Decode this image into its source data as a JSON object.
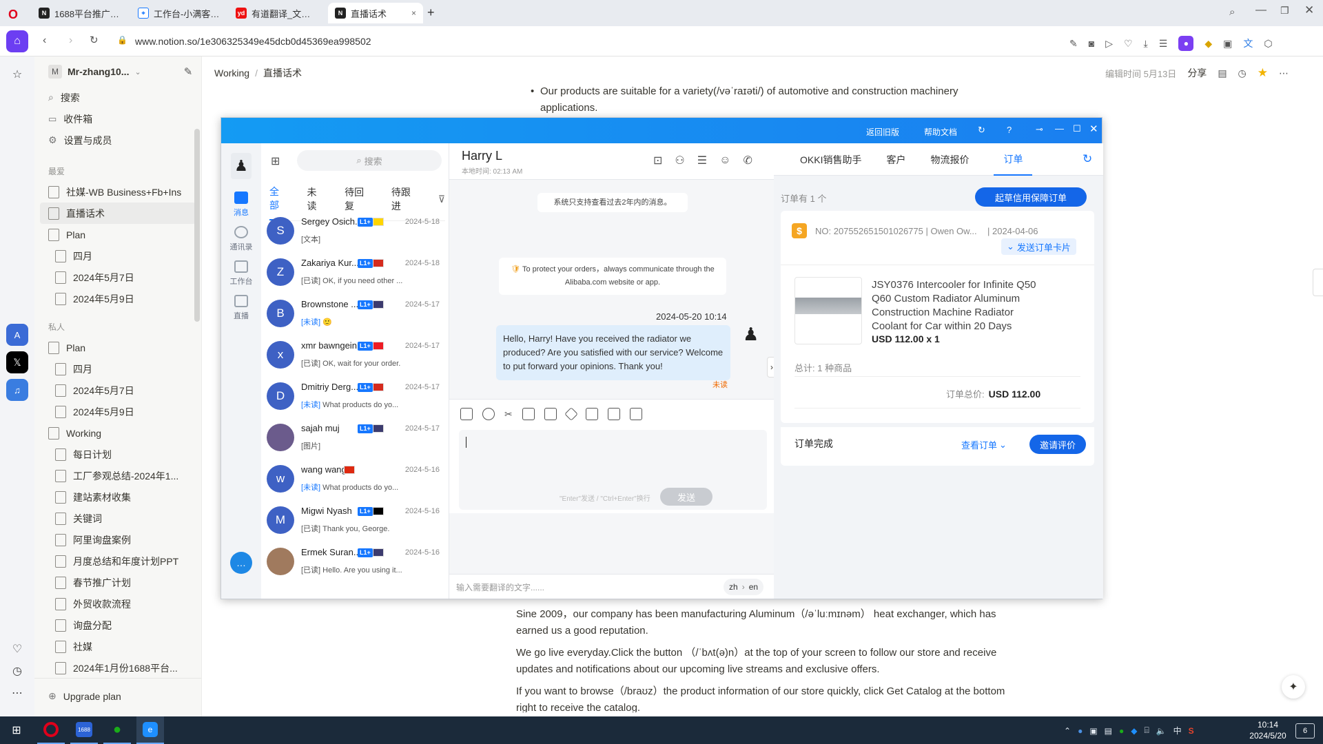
{
  "browser": {
    "tabs": [
      {
        "title": "1688平台推广营销优化 · Notion",
        "favicon": "N"
      },
      {
        "title": "工作台-小满客户管理",
        "favicon": "pin"
      },
      {
        "title": "有道翻译_文本、文档、网",
        "favicon": "yd"
      },
      {
        "title": "直播话术",
        "favicon": "N",
        "close": "×"
      }
    ],
    "new_tab": "+",
    "url": "www.notion.so/1e306325349e45dcb0d45369ea998502"
  },
  "notion": {
    "workspace": "Mr-zhang10...",
    "workspace_avatar": "M",
    "nav": [
      {
        "label": "搜索",
        "icon": "search-icon"
      },
      {
        "label": "收件箱",
        "icon": "inbox-icon"
      },
      {
        "label": "设置与成员",
        "icon": "gear-icon"
      }
    ],
    "favorites_heading": "最爱",
    "favorites": [
      {
        "label": "社媒-WB Business+Fb+Ins",
        "level": 0
      },
      {
        "label": "直播话术",
        "level": 0,
        "active": true
      },
      {
        "label": "Plan",
        "level": 0
      },
      {
        "label": "四月",
        "level": 1
      },
      {
        "label": "2024年5月7日",
        "level": 1
      },
      {
        "label": "2024年5月9日",
        "level": 1
      }
    ],
    "private_heading": "私人",
    "private": [
      {
        "label": "Plan",
        "level": 0
      },
      {
        "label": "四月",
        "level": 1
      },
      {
        "label": "2024年5月7日",
        "level": 1
      },
      {
        "label": "2024年5月9日",
        "level": 1
      },
      {
        "label": "Working",
        "level": 0
      },
      {
        "label": "每日计划",
        "level": 1
      },
      {
        "label": "工厂参观总结-2024年1...",
        "level": 1
      },
      {
        "label": "建站素材收集",
        "level": 1
      },
      {
        "label": "关键词",
        "level": 1
      },
      {
        "label": "阿里询盘案例",
        "level": 1
      },
      {
        "label": "月度总结和年度计划PPT",
        "level": 1
      },
      {
        "label": "春节推广计划",
        "level": 1
      },
      {
        "label": "外贸收款流程",
        "level": 1
      },
      {
        "label": "询盘分配",
        "level": 1
      },
      {
        "label": "社媒",
        "level": 1
      },
      {
        "label": "2024年1月份1688平台...",
        "level": 1
      }
    ],
    "upgrade": "Upgrade plan",
    "breadcrumb": [
      "Working",
      "/",
      "直播话术"
    ],
    "edited": "编辑时间 5月13日",
    "share": "分享",
    "doc_top": "Our products are suitable for a variety(/vəˈraɪəti/) of automotive and construction machinery applications.",
    "doc_paras": [
      "Sine 2009，our company has been manufacturing Aluminum（/əˈluːmɪnəm） heat exchanger, which has earned us a good reputation.",
      "We go live everyday.Click the button （/ˈbʌt(ə)n）at the top of your screen to follow our store and receive updates and notifications about our upcoming live streams and exclusive offers.",
      "If you want to browse（/braʊz）the product information of our store quickly, click Get Catalog at the bottom right to receive the catalog."
    ]
  },
  "chat": {
    "header_buttons": [
      "返回旧版",
      "帮助文档"
    ],
    "nav": [
      {
        "label": "消息",
        "active": true
      },
      {
        "label": "通讯录"
      },
      {
        "label": "工作台"
      },
      {
        "label": "直播"
      }
    ],
    "search_placeholder": "搜索",
    "filter_tabs": [
      "全部",
      "未读",
      "待回复",
      "待跟进"
    ],
    "conversations": [
      {
        "initial": "S",
        "name": "Sergey Osich...",
        "badge": "L1+",
        "date": "2024-5-18",
        "tag": "",
        "preview": "[文本]",
        "color": "#3e61c4"
      },
      {
        "initial": "Z",
        "name": "Zakariya Kur...",
        "badge": "L1+",
        "date": "2024-5-18",
        "tag": "",
        "preview": "[已读] OK, if you need other ...",
        "color": "#3e61c4"
      },
      {
        "initial": "B",
        "name": "Brownstone ...",
        "badge": "L1+",
        "date": "2024-5-17",
        "tag": "[未读]",
        "preview": " 🙂",
        "color": "#3e61c4"
      },
      {
        "initial": "x",
        "name": "xmr bawngein",
        "badge": "L1+",
        "date": "2024-5-17",
        "tag": "",
        "preview": "[已读] OK, wait for your order.",
        "color": "#3e61c4"
      },
      {
        "initial": "D",
        "name": "Dmitriy Derg...",
        "badge": "L1+",
        "date": "2024-5-17",
        "tag": "[未读]",
        "preview": " What products do yo...",
        "color": "#3e61c4"
      },
      {
        "initial": "",
        "name": "sajah muj",
        "badge": "L1+",
        "date": "2024-5-17",
        "tag": "",
        "preview": "[图片]",
        "color": "#6b5b8c"
      },
      {
        "initial": "w",
        "name": "wang wang",
        "badge": "",
        "date": "2024-5-16",
        "tag": "[未读]",
        "preview": " What products do yo...",
        "color": "#3e61c4"
      },
      {
        "initial": "M",
        "name": "Migwi Nyash",
        "badge": "L1+",
        "date": "2024-5-16",
        "tag": "",
        "preview": "[已读] Thank you, George.",
        "color": "#3e61c4"
      },
      {
        "initial": "",
        "name": "Ermek Suran...",
        "badge": "L1+",
        "date": "2024-5-16",
        "tag": "",
        "preview": "[已读] Hello. Are you using it...",
        "color": "#a07a5e"
      }
    ],
    "contact_name": "Harry L",
    "local_time": "本地时间: 02:13 AM",
    "system_note": "系统只支持查看过去2年内的消息。",
    "protect_note": "To protect your orders，always communicate through the Alibaba.com website or app.",
    "msg_time": "2024-05-20 10:14",
    "msg_text": "Hello, Harry! Have you received the radiator we produced? Are you satisfied with our service? Welcome to put forward your opinions. Thank you!",
    "msg_status": "未读",
    "send_hint": "\"Enter\"发送 / \"Ctrl+Enter\"换行",
    "send_label": "发送",
    "translate_placeholder": "输入需要翻译的文字......",
    "lang_from": "zh",
    "lang_arrow": "›",
    "lang_to": "en"
  },
  "panel": {
    "tabs": [
      "OKKI销售助手",
      "客户",
      "物流报价",
      "订单"
    ],
    "active_tab": 3,
    "order_count": "订单有 1 个",
    "draft_button": "起草信用保障订单",
    "order_no": "NO: 207552651501026775 | Owen Ow...",
    "order_date": "| 2024-04-06",
    "send_card": "发送订单卡片",
    "product_title": "JSY0376 Intercooler for Infinite Q50 Q60 Custom Radiator Aluminum Construction Machine Radiator Coolant for Car within 20 Days",
    "product_price": "USD 112.00 x 1",
    "total_items": "总计: 1 种商品",
    "total_label": "订单总价:",
    "total_value": "USD 112.00",
    "status": "订单完成",
    "view_order": "查看订单",
    "invite_review": "邀请评价"
  },
  "taskbar": {
    "time": "10:14",
    "date": "2024/5/20",
    "ime": "中",
    "notif_count": "6"
  },
  "colors": {
    "chat_header": "#149bf3",
    "accent": "#1677ff",
    "notion_sidebar": "#f7f7f5",
    "taskbar": "#1b2a3a"
  }
}
